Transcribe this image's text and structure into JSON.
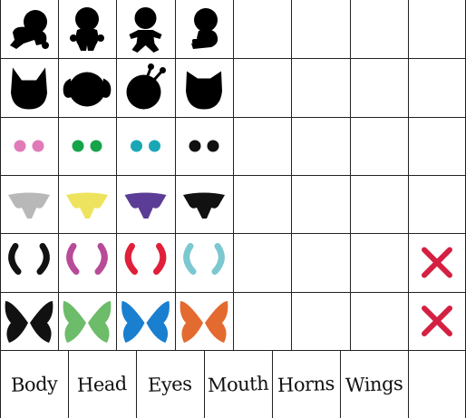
{
  "rows": [
    {
      "category": "body",
      "items": [
        {
          "icon": "body-crawling-icon",
          "color": "#000000"
        },
        {
          "icon": "body-standing-icon",
          "color": "#000000"
        },
        {
          "icon": "body-arms-out-icon",
          "color": "#000000"
        },
        {
          "icon": "body-sitting-icon",
          "color": "#000000"
        }
      ],
      "remove": false
    },
    {
      "category": "head",
      "items": [
        {
          "icon": "head-pointed-ears-icon",
          "color": "#000000"
        },
        {
          "icon": "head-floppy-ears-icon",
          "color": "#000000"
        },
        {
          "icon": "head-antennae-icon",
          "color": "#000000"
        },
        {
          "icon": "head-cat-ears-icon",
          "color": "#000000"
        }
      ],
      "remove": false
    },
    {
      "category": "eyes",
      "items": [
        {
          "icon": "eyes-icon",
          "color": "#e07ab8"
        },
        {
          "icon": "eyes-icon",
          "color": "#16a34a"
        },
        {
          "icon": "eyes-icon",
          "color": "#1aa7b5"
        },
        {
          "icon": "eyes-icon",
          "color": "#111111"
        }
      ],
      "remove": false
    },
    {
      "category": "mouth",
      "items": [
        {
          "icon": "mouth-icon",
          "color": "#b8b8b8"
        },
        {
          "icon": "mouth-icon",
          "color": "#eee35e"
        },
        {
          "icon": "mouth-icon",
          "color": "#5b3d97"
        },
        {
          "icon": "mouth-icon",
          "color": "#111111"
        }
      ],
      "remove": false
    },
    {
      "category": "horns",
      "items": [
        {
          "icon": "horns-icon",
          "color": "#111111"
        },
        {
          "icon": "horns-icon",
          "color": "#b84b98"
        },
        {
          "icon": "horns-icon",
          "color": "#e0203a"
        },
        {
          "icon": "horns-icon",
          "color": "#7cc8d0"
        }
      ],
      "remove": true
    },
    {
      "category": "wings",
      "items": [
        {
          "icon": "wings-icon",
          "color": "#111111"
        },
        {
          "icon": "wings-icon",
          "color": "#6cbc6a"
        },
        {
          "icon": "wings-icon",
          "color": "#1a7fcf"
        },
        {
          "icon": "wings-icon",
          "color": "#e36b2f"
        }
      ],
      "remove": true
    }
  ],
  "remove_icon": {
    "icon": "remove-x-icon",
    "color": "#d42042"
  },
  "tabs": [
    {
      "label": "Body"
    },
    {
      "label": "Head"
    },
    {
      "label": "Eyes"
    },
    {
      "label": "Mouth"
    },
    {
      "label": "Horns"
    },
    {
      "label": "Wings"
    },
    {
      "label": ""
    }
  ]
}
